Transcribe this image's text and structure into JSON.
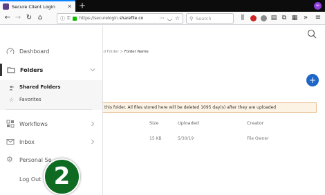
{
  "browser": {
    "tab_title": "Secure Client Login",
    "url_prefix": "https://securelogin.",
    "url_domain": "sharefile.co",
    "search_placeholder": "Search",
    "icons": [
      "back-icon",
      "forward-icon",
      "reload-icon",
      "home-icon",
      "library-icon",
      "menu-icon"
    ]
  },
  "main": {
    "breadcrumb_parent": "nd Folder",
    "breadcrumb_sep": ">",
    "breadcrumb_current": "Folder Name",
    "add_label": "+",
    "banner_text": "this folder. All files stored here will be deleted 1095 day(s) after they are uploaded",
    "columns": [
      "Size",
      "Uploaded",
      "Creator"
    ],
    "rows": [
      {
        "size": "15 KB",
        "uploaded": "5/30/19",
        "creator": "File Owner"
      }
    ]
  },
  "sidebar": {
    "items": [
      {
        "label": "Dashboard"
      },
      {
        "label": "Folders"
      },
      {
        "label": "Workflows"
      },
      {
        "label": "Inbox"
      },
      {
        "label": "Personal Se"
      },
      {
        "label": "Log Out"
      }
    ],
    "sub_items": [
      {
        "label": "Shared Folders"
      },
      {
        "label": "Favorites"
      }
    ]
  },
  "overlay": {
    "step_number": "2"
  },
  "colors": {
    "accent": "#1e66c7",
    "step_badge": "#0f6b22",
    "banner_bg": "#fdf3e4",
    "banner_border": "#eac49a"
  }
}
